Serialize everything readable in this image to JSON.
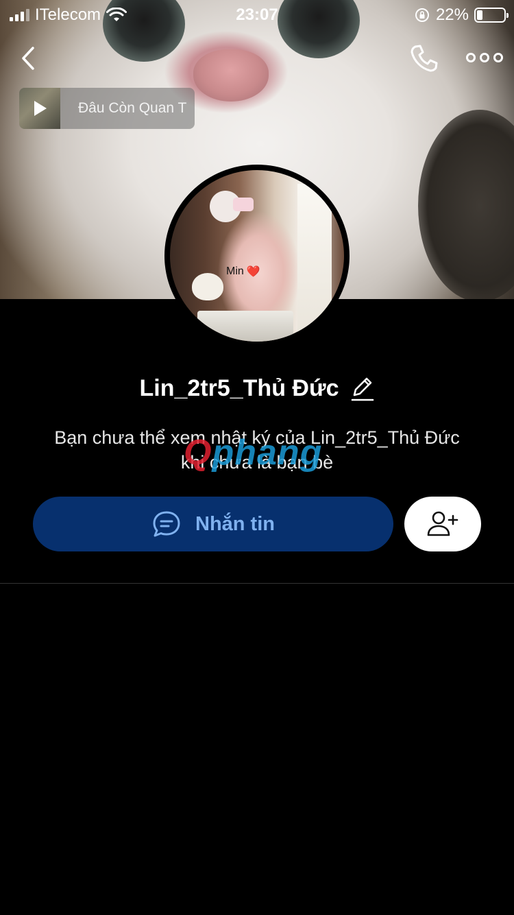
{
  "status_bar": {
    "carrier": "ITelecom",
    "time": "23:07",
    "battery_percent": "22%",
    "battery_level": 0.22,
    "icons": [
      "signal-icon",
      "wifi-icon",
      "orientation-lock-icon",
      "battery-icon"
    ]
  },
  "header": {
    "icons": [
      "back-chevron-icon",
      "phone-icon",
      "more-options-icon"
    ]
  },
  "music": {
    "title": "Đâu Còn Quan T",
    "icon": "play-icon"
  },
  "avatar": {
    "caption": "Min",
    "caption_emoji": "❤️"
  },
  "profile": {
    "name": "Lin_2tr5_Thủ Đức",
    "edit_icon": "pencil-icon",
    "privacy_note": "Bạn chưa thể xem nhật ký của Lin_2tr5_Thủ Đức khi chưa là bạn bè"
  },
  "watermark": {
    "part1": "Q",
    "part2": "phang"
  },
  "actions": {
    "message_label": "Nhắn tin",
    "message_icon": "chat-bubble-icon",
    "add_friend_icon": "add-friend-icon",
    "accent_color": "#07306e",
    "accent_text_color": "#7fb1ef"
  }
}
